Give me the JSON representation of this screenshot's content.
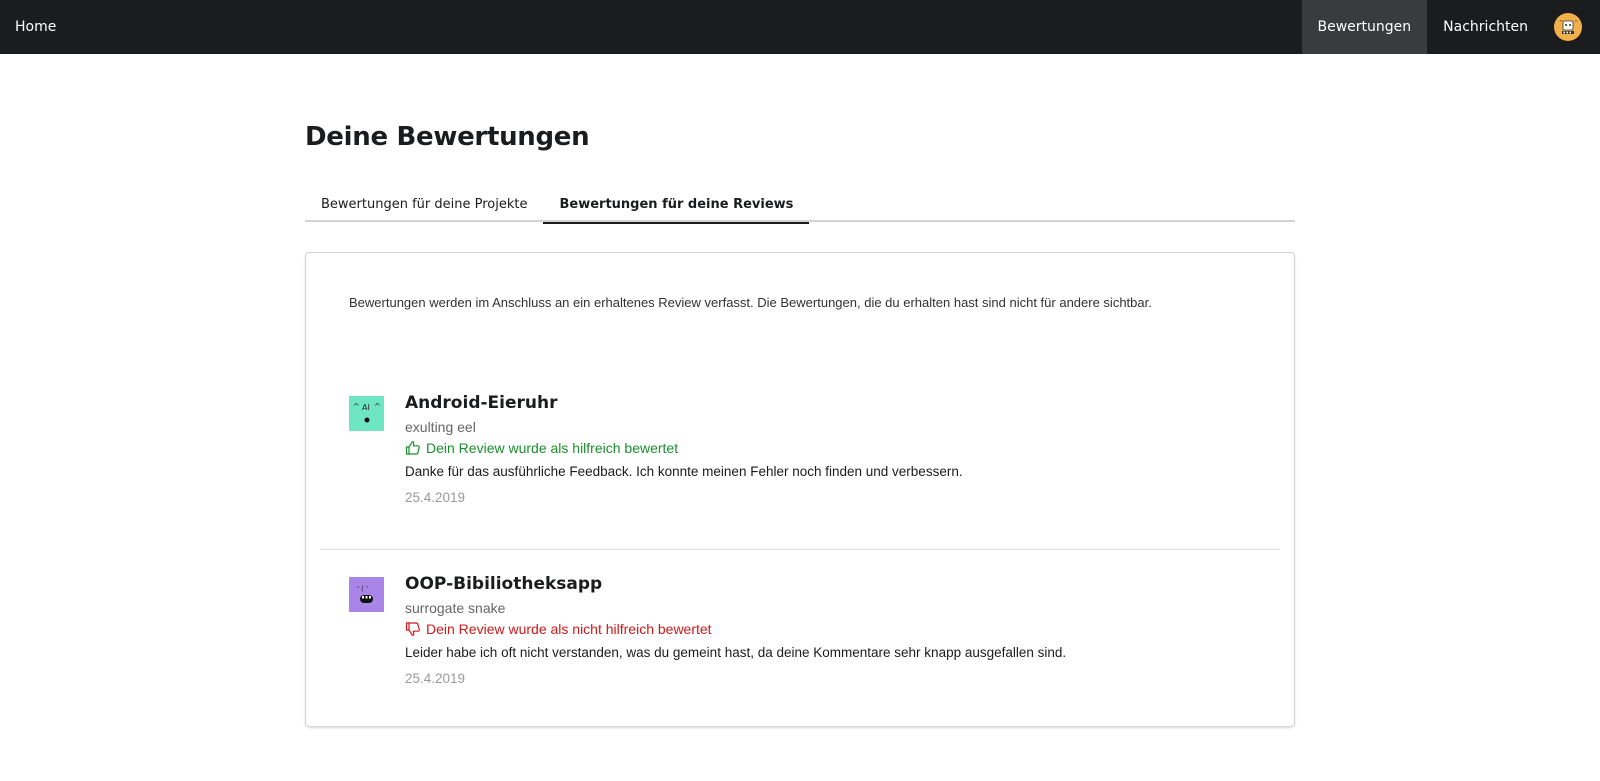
{
  "navbar": {
    "home_label": "Home",
    "items": [
      {
        "label": "Bewertungen",
        "active": true
      },
      {
        "label": "Nachrichten",
        "active": false
      }
    ],
    "avatar_icon": "user-avatar-icon",
    "avatar_color": "#f2b04a"
  },
  "page": {
    "title": "Deine Bewertungen"
  },
  "tabs": [
    {
      "label": "Bewertungen für deine Projekte",
      "active": false
    },
    {
      "label": "Bewertungen für deine Reviews",
      "active": true
    }
  ],
  "card": {
    "info_text": "Bewertungen werden im Anschluss an ein erhaltenes Review verfasst. Die Bewertungen, die du erhalten hast sind nicht für andere sichtbar.",
    "reviews": [
      {
        "project": "Android-Eieruhr",
        "author": "exulting eel",
        "verdict": "Dein Review wurde als hilfreich bewertet",
        "verdict_type": "positive",
        "verdict_icon": "thumbs-up-icon",
        "comment": "Danke für das ausführliche Feedback. Ich konnte meinen Fehler noch finden und verbessern.",
        "date": "25.4.2019",
        "avatar_color": "#6ee6c4"
      },
      {
        "project": "OOP-Bibiliotheksapp",
        "author": "surrogate snake",
        "verdict": "Dein Review wurde als nicht hilfreich bewertet",
        "verdict_type": "negative",
        "verdict_icon": "thumbs-down-icon",
        "comment": "Leider habe ich oft nicht verstanden, was du gemeint hast, da deine Kommentare sehr knapp ausgefallen sind.",
        "date": "25.4.2019",
        "avatar_color": "#a985e8"
      }
    ]
  },
  "colors": {
    "navbar_bg": "#1b1c1d",
    "positive": "#1a8f2b",
    "negative": "#d01919"
  }
}
